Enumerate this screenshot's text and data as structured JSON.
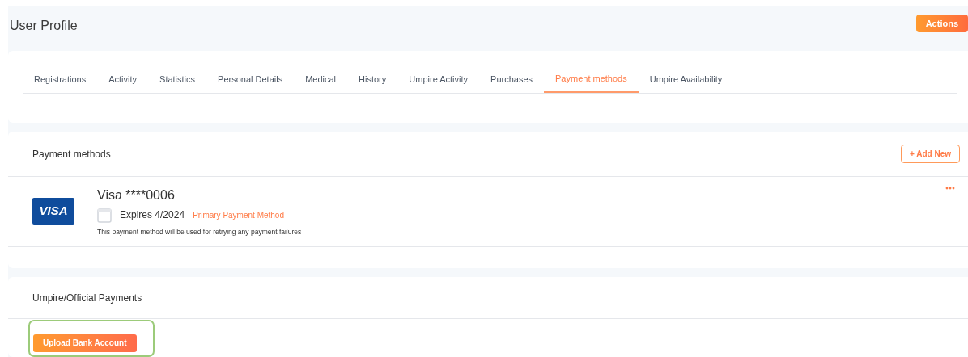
{
  "header": {
    "title": "User Profile",
    "actions_button": "Actions"
  },
  "tabs": [
    {
      "label": "Registrations",
      "selected": false
    },
    {
      "label": "Activity",
      "selected": false
    },
    {
      "label": "Statistics",
      "selected": false
    },
    {
      "label": "Personal Details",
      "selected": false
    },
    {
      "label": "Medical",
      "selected": false
    },
    {
      "label": "History",
      "selected": false
    },
    {
      "label": "Umpire Activity",
      "selected": false
    },
    {
      "label": "Purchases",
      "selected": false
    },
    {
      "label": "Payment methods",
      "selected": true
    },
    {
      "label": "Umpire Availability",
      "selected": false
    }
  ],
  "payment_methods": {
    "title": "Payment methods",
    "add_button": "+ Add New",
    "cards": [
      {
        "brand_logo": "VISA",
        "name": "Visa ****0006",
        "expires": "Expires 4/2024",
        "primary_label": "- Primary Payment Method",
        "note": "This payment method will be used for retrying any payment failures"
      }
    ]
  },
  "umpire_payments": {
    "title": "Umpire/Official Payments",
    "upload_button": "Upload Bank Account",
    "highlighted": true
  }
}
